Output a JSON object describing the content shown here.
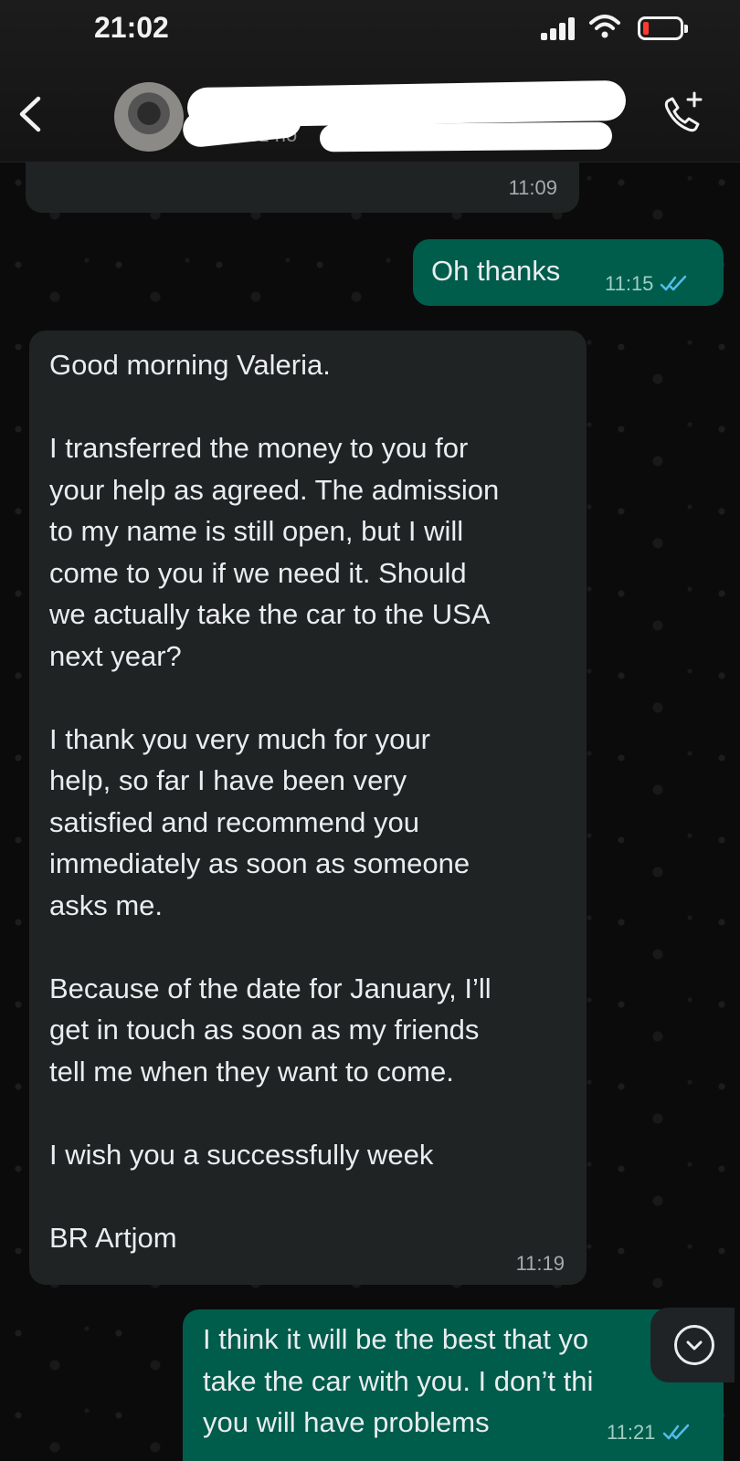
{
  "status_bar": {
    "time": "21:02",
    "signal_icon": "cellular-signal-icon",
    "wifi_icon": "wifi-icon",
    "battery_icon": "battery-low-icon",
    "battery_color": "#ff3b30"
  },
  "header": {
    "back_icon": "chevron-left-icon",
    "contact_name": "",
    "contact_status": "últ. vez ho",
    "add_call_icon": "phone-plus-icon"
  },
  "colors": {
    "incoming_bubble": "#202324",
    "outgoing_bubble": "#005c4b",
    "read_ticks": "#53bdeb"
  },
  "messages": [
    {
      "direction": "in",
      "text": "",
      "time": "11:09"
    },
    {
      "direction": "out",
      "text": "Oh thanks",
      "time": "11:15",
      "status": "read"
    },
    {
      "direction": "in",
      "text": "Good morning Valeria.\n\nI transferred the money to you for\nyour help as agreed. The admission\nto my name is still open, but I will\ncome to you if we need it. Should\nwe actually take the car to the USA\nnext year?\n\nI thank you very much for your\nhelp, so far I have been very\nsatisfied and recommend you\nimmediately as soon as someone\nasks me.\n\nBecause of the date for January, I’ll\nget in touch as soon as my friends\ntell me when they want to come.\n\nI wish you a successfully week\n\nBR Artjom",
      "time": "11:19"
    },
    {
      "direction": "out",
      "text": "I think it will be the best that yo\ntake the car with you. I don’t thi\nyou will have problems",
      "time": "11:21",
      "status": "read"
    }
  ],
  "scroll_down_icon": "chevron-down-circle-icon"
}
